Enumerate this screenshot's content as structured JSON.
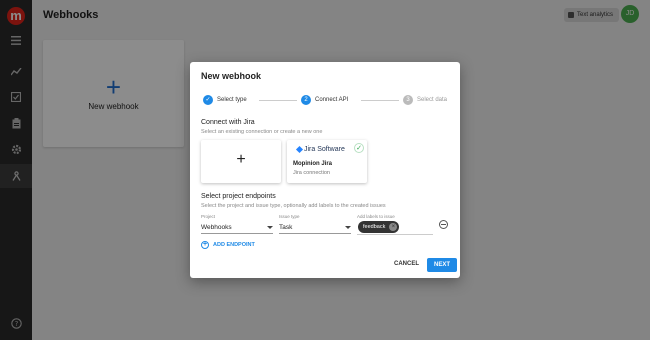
{
  "app": {
    "logo_letter": "m",
    "page_title": "Webhooks",
    "text_analytics_label": "Text analytics",
    "avatar_initials": "JD"
  },
  "sidebar": {
    "items": [
      {
        "icon": "menu-icon"
      },
      {
        "icon": "chart-icon"
      },
      {
        "icon": "checklist-icon"
      },
      {
        "icon": "clipboard-icon"
      },
      {
        "icon": "gear-icon"
      },
      {
        "icon": "webhook-icon"
      },
      {
        "icon": "help-icon"
      }
    ]
  },
  "background": {
    "new_webhook_plus": "+",
    "new_webhook_label": "New webhook"
  },
  "modal": {
    "title": "New webhook",
    "steps": [
      {
        "label": "Select type",
        "state": "done"
      },
      {
        "label": "Connect API",
        "state": "active",
        "number": "2"
      },
      {
        "label": "Select data",
        "state": "inactive",
        "number": "3"
      }
    ],
    "connect": {
      "title": "Connect with Jira",
      "subtitle": "Select an existing connection or create a new one",
      "add_symbol": "+",
      "jira_logo_text": "Jira Software",
      "connection_name": "Mopinion Jira",
      "connection_sub": "Jira connection"
    },
    "endpoints": {
      "title": "Select project endpoints",
      "subtitle": "Select the project and issue type, optionally add labels to the created issues",
      "project_label": "Project",
      "project_value": "Webhooks",
      "issue_type_label": "Issue type",
      "issue_type_value": "Task",
      "labels_label": "Add labels to issue",
      "chip_label": "feedback",
      "add_endpoint_label": "ADD ENDPOINT"
    },
    "cancel_label": "CANCEL",
    "next_label": "NEXT"
  },
  "colors": {
    "accent": "#1f8ae6",
    "brand": "#e2231a",
    "sidebar": "#2b2b2b"
  }
}
